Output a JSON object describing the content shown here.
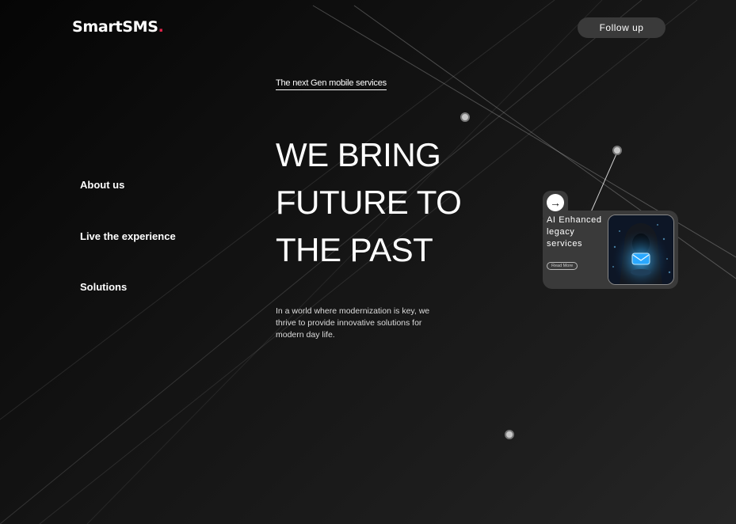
{
  "brand": {
    "name": "SmartSMS",
    "dot": "."
  },
  "header": {
    "follow_label": "Follow up"
  },
  "hero": {
    "tagline": "The next Gen mobile services",
    "lines": [
      "WE BRING",
      "FUTURE TO",
      "THE PAST"
    ],
    "description": "In a world where modernization is key, we thrive to provide innovative solutions for modern day life."
  },
  "nav": {
    "items": [
      {
        "label": "About us"
      },
      {
        "label": "Live the experience"
      },
      {
        "label": "Solutions"
      }
    ]
  },
  "card": {
    "title": "AI Enhanced legacy services",
    "read_more": "Read More",
    "arrow_icon": "arrow-right-icon",
    "image_icon": "hooded-figure-message-illustration"
  },
  "colors": {
    "accent": "#e0244a",
    "button_bg": "#3a3a3a",
    "card_bg": "#3a3a3a"
  }
}
